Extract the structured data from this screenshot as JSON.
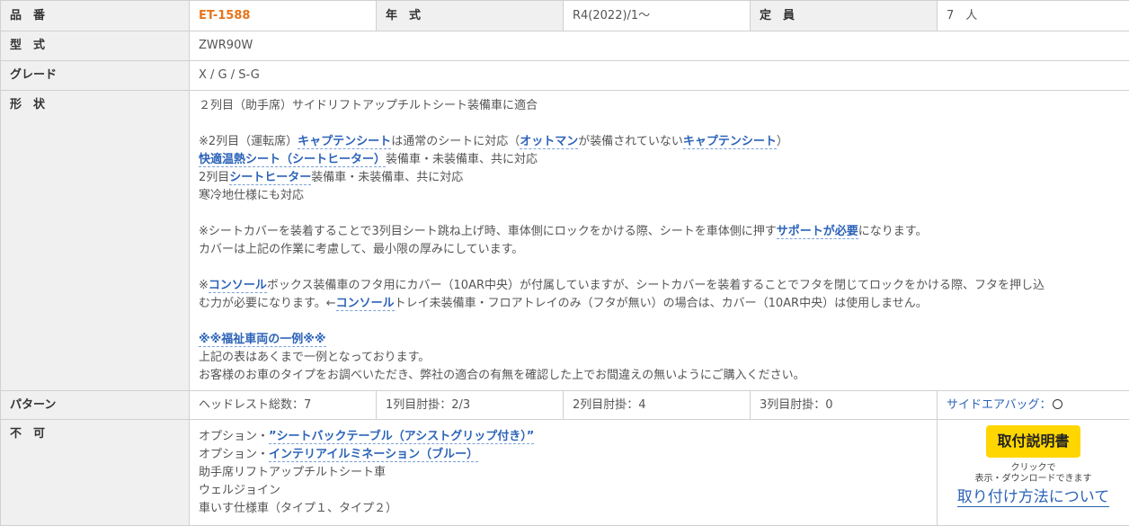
{
  "rows": {
    "product_no": {
      "label": "品　番",
      "value": "ET-1588"
    },
    "year": {
      "label": "年　式",
      "value": "R4(2022)/1～"
    },
    "capacity": {
      "label": "定　員",
      "value": "7　人"
    },
    "model": {
      "label": "型　式",
      "value": "ZWR90W"
    },
    "grade": {
      "label": "グレード",
      "value": "X / G / S-G"
    },
    "shape": {
      "label": "形　状"
    },
    "pattern": {
      "label": "パターン",
      "headrest": "ヘッドレスト総数：7",
      "row1": "1列目肘掛：2/3",
      "row2": "2列目肘掛：4",
      "row3": "3列目肘掛：0",
      "side_airbag": "サイドエアバッグ：",
      "side_airbag_mark": "circle"
    },
    "not_possible": {
      "label": "不　可"
    }
  },
  "shape": {
    "line1": "２列目（助手席）サイドリフトアップチルトシート装備車に適合",
    "p1": {
      "a": "※2列目（運転席）",
      "kw1": "キャプテンシート",
      "b": "は通常のシートに対応（",
      "kw2": "オットマン",
      "c": "が装備されていない",
      "kw3": "キャプテンシート",
      "d": "）"
    },
    "p2": {
      "kw": "快適温熱シート（シートヒーター）",
      "a": "装備車・未装備車、共に対応"
    },
    "p3": {
      "a": "2列目",
      "kw": "シートヒーター",
      "b": "装備車・未装備車、共に対応"
    },
    "p4": "寒冷地仕様にも対応",
    "p5": {
      "a": "※シートカバーを装着することで3列目シート跳ね上げ時、車体側にロックをかける際、シートを車体側に押す",
      "kw": "サポートが必要",
      "b": "になります。"
    },
    "p6": "カバーは上記の作業に考慮して、最小限の厚みにしています。",
    "p7": {
      "a": "※",
      "kw": "コンソール",
      "b": "ボックス装備車のフタ用にカバー（10AR中央）が付属していますが、シートカバーを装着することでフタを閉じてロックをかける際、フタを押し込"
    },
    "p8": {
      "a": "む力が必要になります。←",
      "kw": "コンソール",
      "b": "トレイ未装備車・フロアトレイのみ（フタが無い）の場合は、カバー（10AR中央）は使用しません。"
    },
    "p9": "※※福祉車両の一例※※",
    "p10": "上記の表はあくまで一例となっております。",
    "p11": "お客様のお車のタイプをお調べいただき、弊社の適合の有無を確認した上でお間違えの無いようにご購入ください。"
  },
  "not_possible": {
    "item1": {
      "a": "オプション・",
      "kw": "”シートバックテーブル（アシストグリップ付き）”"
    },
    "item2": {
      "a": "オプション・",
      "kw": "インテリアイルミネーション（ブルー）"
    },
    "item3": "助手席リフトアップチルトシート車",
    "item4": "ウェルジョイン",
    "item5": "車いす仕様車（タイプ１、タイプ２）"
  },
  "manual": {
    "button": "取付説明書",
    "note1": "クリックで",
    "note2": "表示・ダウンロードできます",
    "link": "取り付け方法について"
  },
  "colors": {
    "product_no": "#e8741a",
    "keyword": "#2c63b8",
    "header_bg": "#f0f0f0",
    "button_bg": "#ffd600",
    "border": "#d0d0d0"
  }
}
